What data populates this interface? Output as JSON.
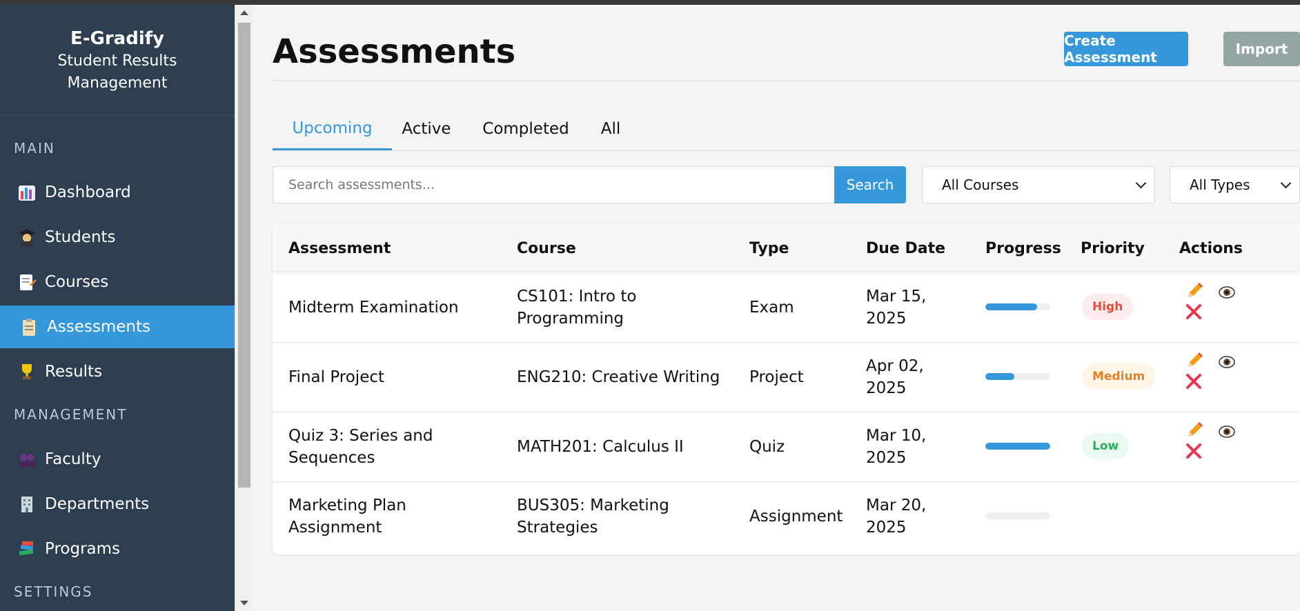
{
  "sidebar": {
    "brand_name": "E-Gradify",
    "brand_sub_line1": "Student Results",
    "brand_sub_line2": "Management",
    "sections": [
      "MAIN",
      "MANAGEMENT",
      "SETTINGS"
    ],
    "items": [
      {
        "label": "Dashboard",
        "icon": "bar-chart-icon"
      },
      {
        "label": "Students",
        "icon": "graduate-icon"
      },
      {
        "label": "Courses",
        "icon": "memo-icon"
      },
      {
        "label": "Assessments",
        "icon": "clipboard-icon",
        "active": true
      },
      {
        "label": "Results",
        "icon": "trophy-icon"
      },
      {
        "label": "Faculty",
        "icon": "people-icon"
      },
      {
        "label": "Departments",
        "icon": "building-icon"
      },
      {
        "label": "Programs",
        "icon": "books-icon"
      }
    ]
  },
  "header": {
    "title": "Assessments",
    "create_label": "Create Assessment",
    "import_label": "Import"
  },
  "tabs": [
    "Upcoming",
    "Active",
    "Completed",
    "All"
  ],
  "filters": {
    "search_placeholder": "Search assessments...",
    "search_button": "Search",
    "course_select": "All Courses",
    "type_select": "All Types"
  },
  "table": {
    "columns": [
      "Assessment",
      "Course",
      "Type",
      "Due Date",
      "Progress",
      "Priority",
      "Actions"
    ],
    "rows": [
      {
        "assessment_l1": "Midterm Examination",
        "assessment_l2": "",
        "course_l1": "CS101: Intro to",
        "course_l2": "Programming",
        "type": "Exam",
        "due_l1": "Mar 15,",
        "due_l2": "2025",
        "progress": 0.8,
        "priority": "High"
      },
      {
        "assessment_l1": "Final Project",
        "assessment_l2": "",
        "course_l1": "ENG210: Creative Writing",
        "course_l2": "",
        "type": "Project",
        "due_l1": "Apr 02,",
        "due_l2": "2025",
        "progress": 0.45,
        "priority": "Medium"
      },
      {
        "assessment_l1": "Quiz 3: Series and",
        "assessment_l2": "Sequences",
        "course_l1": "MATH201: Calculus II",
        "course_l2": "",
        "type": "Quiz",
        "due_l1": "Mar 10,",
        "due_l2": "2025",
        "progress": 1.0,
        "priority": "Low"
      },
      {
        "assessment_l1": "Marketing Plan",
        "assessment_l2": "Assignment",
        "course_l1": "BUS305: Marketing",
        "course_l2": "Strategies",
        "type": "Assignment",
        "due_l1": "Mar 20,",
        "due_l2": "2025",
        "progress": 0.0,
        "priority": ""
      }
    ]
  },
  "colors": {
    "sidebar_bg": "#2c3e50",
    "accent": "#3498db",
    "import_bg": "#95a5a6",
    "high_bg": "#fdecec",
    "high_fg": "#e74c3c",
    "medium_bg": "#fef5e7",
    "medium_fg": "#e67e22",
    "low_bg": "#eafaf1",
    "low_fg": "#27ae60"
  }
}
